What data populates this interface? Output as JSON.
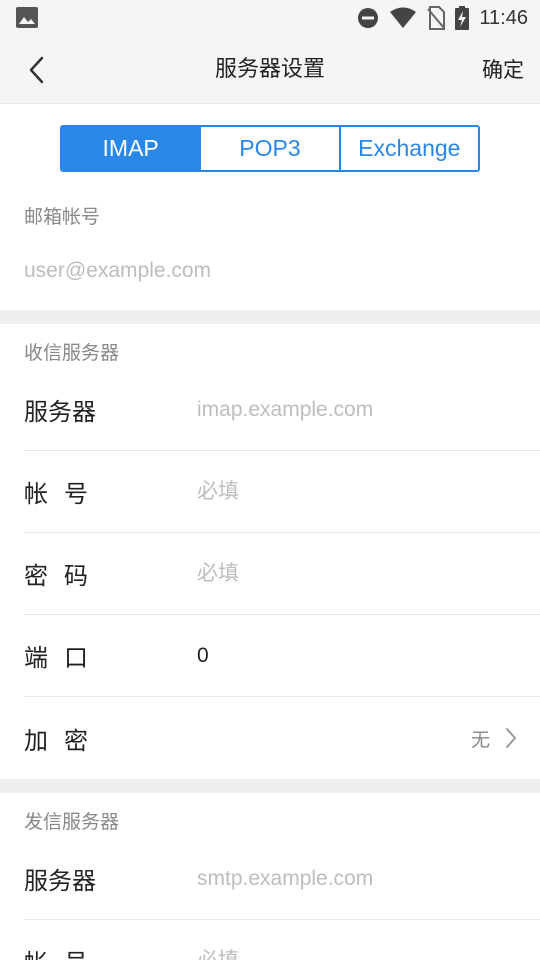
{
  "status_bar": {
    "time": "11:46",
    "icons": [
      "gallery-icon",
      "dnd-icon",
      "wifi-icon",
      "no-sim-icon",
      "battery-charging-icon"
    ]
  },
  "nav": {
    "title": "服务器设置",
    "confirm_label": "确定",
    "back_icon": "chevron-left-icon"
  },
  "protocol_tabs": [
    {
      "label": "IMAP",
      "active": true
    },
    {
      "label": "POP3",
      "active": false
    },
    {
      "label": "Exchange",
      "active": false
    }
  ],
  "account": {
    "label": "邮箱帐号",
    "placeholder": "user@example.com"
  },
  "incoming": {
    "section_label": "收信服务器",
    "server_label": "服务器",
    "server_placeholder": "imap.example.com",
    "account_label": "帐号",
    "account_placeholder": "必填",
    "password_label": "密码",
    "password_placeholder": "必填",
    "port_label": "端口",
    "port_value": "0",
    "encryption_label": "加密",
    "encryption_value": "无"
  },
  "outgoing": {
    "section_label": "发信服务器",
    "server_label": "服务器",
    "server_placeholder": "smtp.example.com",
    "account_label": "帐号",
    "account_placeholder": "必填"
  },
  "colors": {
    "accent": "#2a87e8",
    "background": "#ffffff",
    "band": "#efefef",
    "placeholder": "#bdbdbd"
  }
}
